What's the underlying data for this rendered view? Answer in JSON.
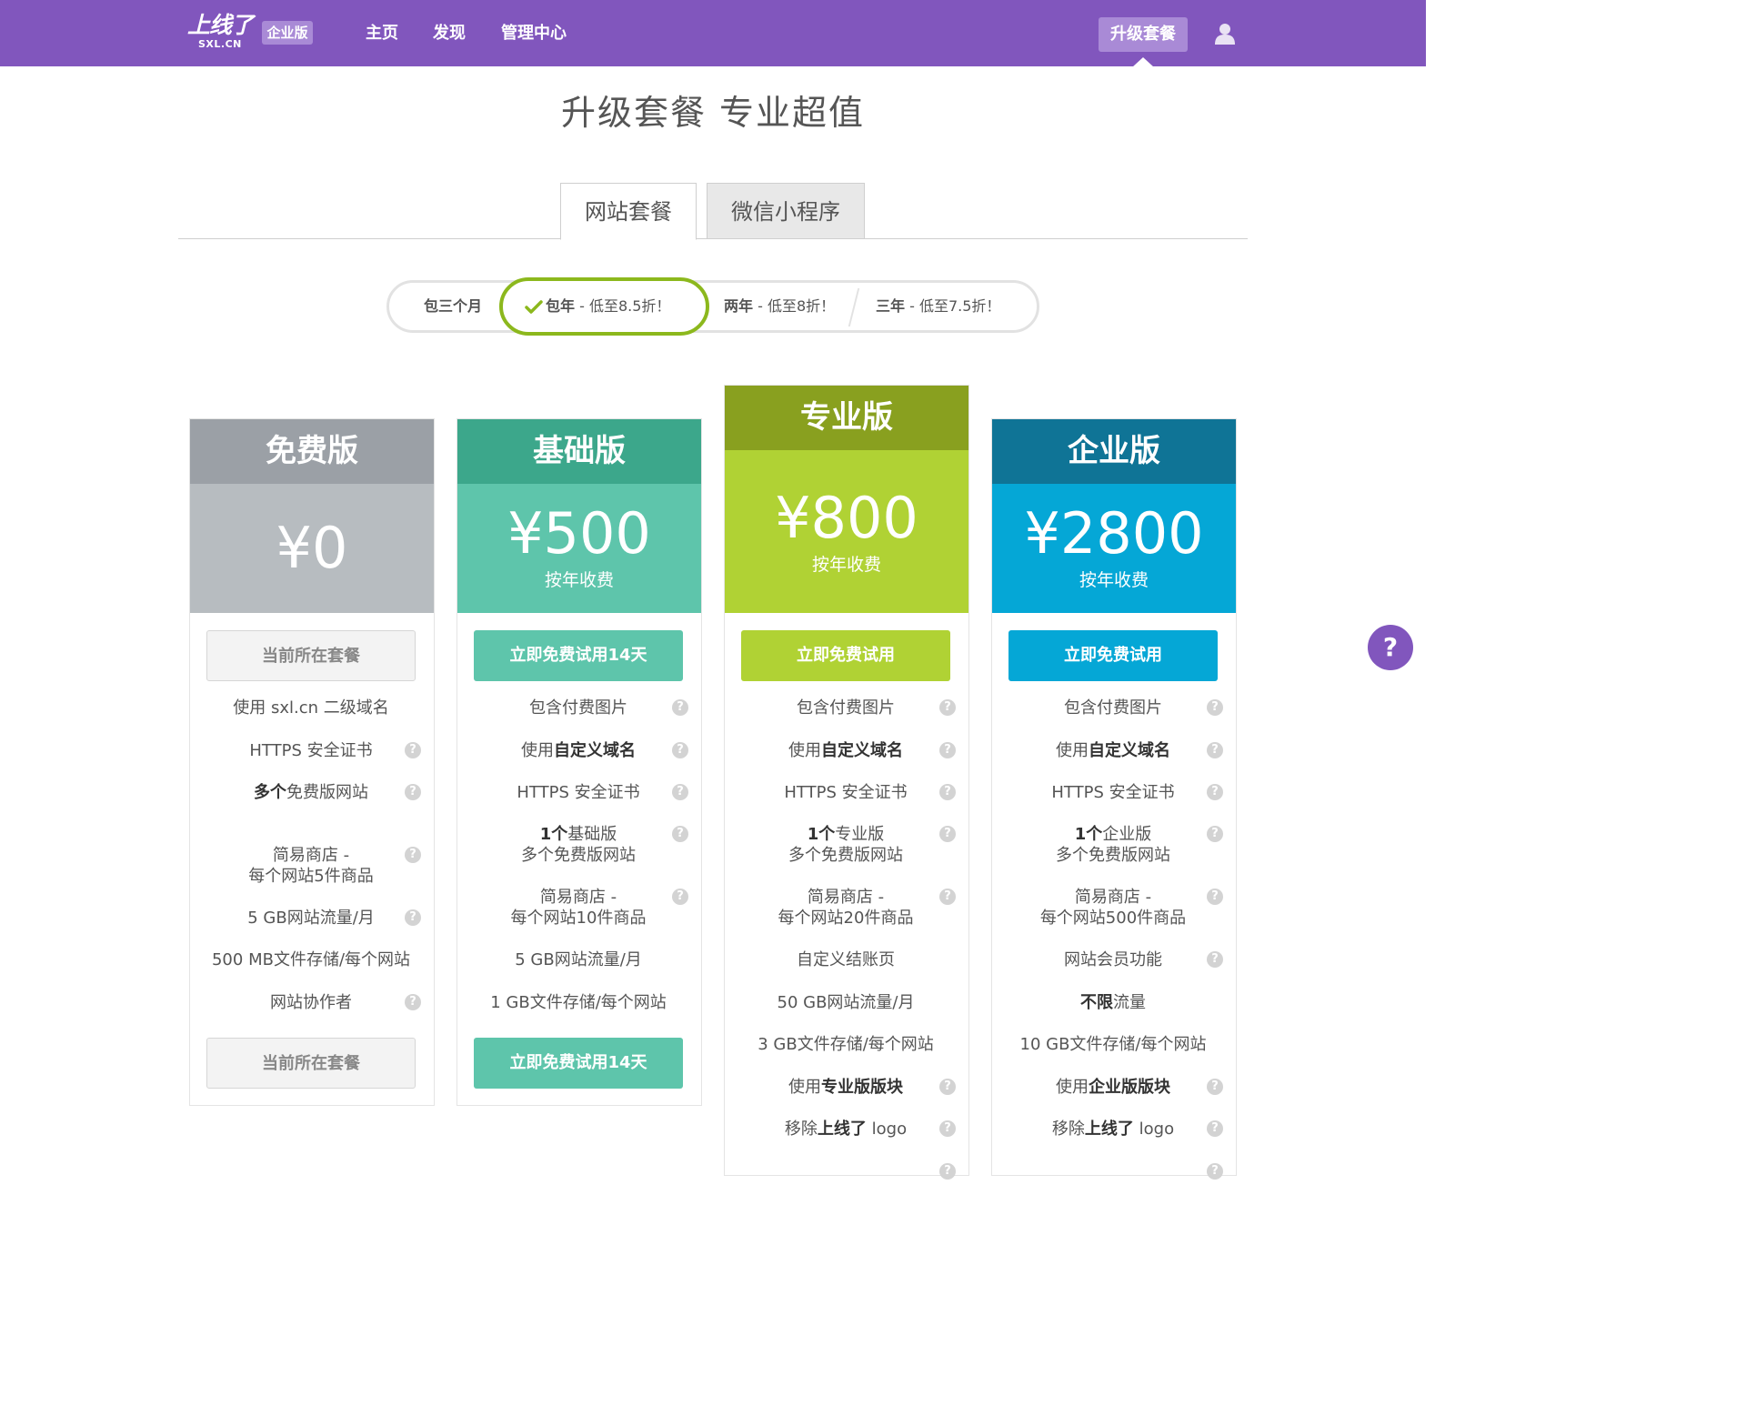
{
  "header": {
    "logo_main": "上线了",
    "logo_sub": "SXL.CN",
    "badge": "企业版",
    "nav": [
      "主页",
      "发现",
      "管理中心"
    ],
    "upgrade": "升级套餐",
    "user_icon": "user-icon"
  },
  "title": "升级套餐 专业超值",
  "tabs": [
    "网站套餐",
    "微信小程序"
  ],
  "periods": {
    "p1": "包三个月",
    "p2_a": "包年",
    "p2_b": " - 低至8.5折！",
    "p3_a": "两年",
    "p3_b": " - 低至8折！",
    "p4_a": "三年",
    "p4_b": " - 低至7.5折！"
  },
  "plans": [
    {
      "name": "免费版",
      "price": "¥0",
      "unit": "",
      "cta": "当前所在套餐",
      "cta_bottom": "当前所在套餐",
      "colors": {
        "head": "#9ba0a6",
        "body": "#b7bcc0",
        "cta": "#f3f3f3"
      }
    },
    {
      "name": "基础版",
      "price": "¥500",
      "unit": "按年收费",
      "cta": "立即免费试用14天",
      "cta_bottom": "立即免费试用14天",
      "colors": {
        "head": "#3ca78b",
        "body": "#5ec5ab",
        "cta": "#5ec5ab"
      }
    },
    {
      "name": "专业版",
      "price": "¥800",
      "unit": "按年收费",
      "cta": "立即免费试用",
      "colors": {
        "head": "#89a01f",
        "body": "#b0d234",
        "cta": "#b0d234"
      }
    },
    {
      "name": "企业版",
      "price": "¥2800",
      "unit": "按年收费",
      "cta": "立即免费试用",
      "colors": {
        "head": "#0f7496",
        "body": "#05a7d6",
        "cta": "#05a7d6"
      }
    }
  ],
  "features": {
    "free": {
      "f1": "使用 sxl.cn 二级域名",
      "f2": "HTTPS 安全证书",
      "f3_b": "多个",
      "f3": "免费版网站",
      "f4_1": "简易商店 -",
      "f4_2": "每个网站5件商品",
      "f5": "5 GB网站流量/月",
      "f6": "500 MB文件存储/每个网站",
      "f7": "网站协作者"
    },
    "basic": {
      "f1": "包含付费图片",
      "f2_a": "使用",
      "f2_b": "自定义域名",
      "f3": "HTTPS 安全证书",
      "f4_b": "1个",
      "f4_1": "基础版",
      "f4_2": "多个免费版网站",
      "f5_1": "简易商店 -",
      "f5_2": "每个网站10件商品",
      "f6": "5 GB网站流量/月",
      "f7": "1 GB文件存储/每个网站"
    },
    "pro": {
      "f1": "包含付费图片",
      "f2_a": "使用",
      "f2_b": "自定义域名",
      "f3": "HTTPS 安全证书",
      "f4_b": "1个",
      "f4_1": "专业版",
      "f4_2": "多个免费版网站",
      "f5_1": "简易商店 -",
      "f5_2": "每个网站20件商品",
      "f6": "自定义结账页",
      "f7": "50 GB网站流量/月",
      "f8": "3 GB文件存储/每个网站",
      "f9_a": "使用",
      "f9_b": "专业版版块",
      "f10_a": "移除",
      "f10_b": "上线了",
      "f10_c": " logo"
    },
    "ent": {
      "f1": "包含付费图片",
      "f2_a": "使用",
      "f2_b": "自定义域名",
      "f3": "HTTPS 安全证书",
      "f4_b": "1个",
      "f4_1": "企业版",
      "f4_2": "多个免费版网站",
      "f5_1": "简易商店 -",
      "f5_2": "每个网站500件商品",
      "f6": "网站会员功能",
      "f7_b": "不限",
      "f7": "流量",
      "f8": "10 GB文件存储/每个网站",
      "f9_a": "使用",
      "f9_b": "企业版版块",
      "f10_a": "移除",
      "f10_b": "上线了",
      "f10_c": " logo"
    }
  },
  "help_mark": "?"
}
